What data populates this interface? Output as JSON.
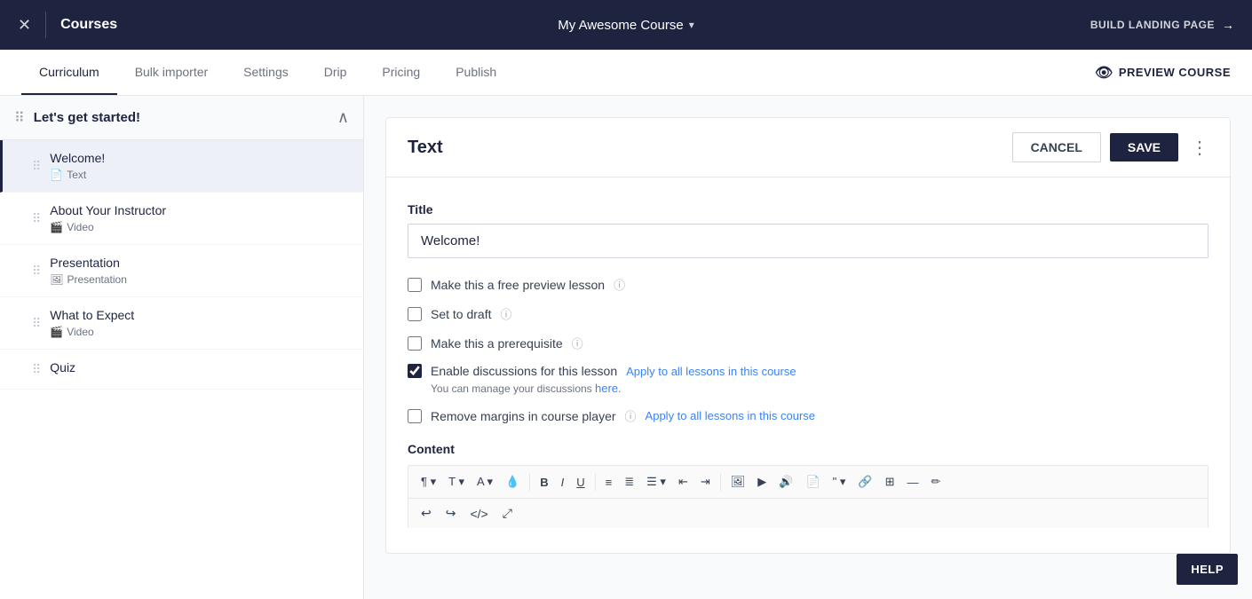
{
  "topBar": {
    "closeIcon": "✕",
    "coursesLabel": "Courses",
    "courseTitle": "My Awesome Course",
    "dropdownArrow": "▾",
    "buildLandingPage": "BUILD LANDING PAGE",
    "arrowRight": "→"
  },
  "tabs": [
    {
      "id": "curriculum",
      "label": "Curriculum",
      "active": true
    },
    {
      "id": "bulk-importer",
      "label": "Bulk importer",
      "active": false
    },
    {
      "id": "settings",
      "label": "Settings",
      "active": false
    },
    {
      "id": "drip",
      "label": "Drip",
      "active": false
    },
    {
      "id": "pricing",
      "label": "Pricing",
      "active": false
    },
    {
      "id": "publish",
      "label": "Publish",
      "active": false
    }
  ],
  "previewCourse": "PREVIEW COURSE",
  "sidebar": {
    "section": {
      "title": "Let's get started!"
    },
    "lessons": [
      {
        "id": "welcome",
        "title": "Welcome!",
        "type": "Text",
        "typeIcon": "📄",
        "active": true
      },
      {
        "id": "about",
        "title": "About Your Instructor",
        "type": "Video",
        "typeIcon": "🎬",
        "active": false
      },
      {
        "id": "presentation",
        "title": "Presentation",
        "type": "Presentation",
        "typeIcon": "🖼",
        "active": false
      },
      {
        "id": "expect",
        "title": "What to Expect",
        "type": "Video",
        "typeIcon": "🎬",
        "active": false
      },
      {
        "id": "quiz",
        "title": "Quiz",
        "type": "",
        "typeIcon": "",
        "active": false
      }
    ]
  },
  "editor": {
    "title": "Text",
    "cancelLabel": "CANCEL",
    "saveLabel": "SAVE",
    "fieldLabel": "Title",
    "titleValue": "Welcome!",
    "checkboxes": [
      {
        "id": "free-preview",
        "label": "Make this a free preview lesson",
        "checked": false,
        "hasInfo": true
      },
      {
        "id": "draft",
        "label": "Set to draft",
        "checked": false,
        "hasInfo": true
      },
      {
        "id": "prerequisite",
        "label": "Make this a prerequisite",
        "checked": false,
        "hasInfo": true
      },
      {
        "id": "discussions",
        "label": "Enable discussions for this lesson",
        "checked": true,
        "hasInfo": false,
        "hasLink": true,
        "linkText": "Apply to all lessons in this course"
      },
      {
        "id": "margins",
        "label": "Remove margins in course player",
        "checked": false,
        "hasInfo": true,
        "hasLink": true,
        "linkText": "Apply to all lessons in this course"
      }
    ],
    "discussionsSubtext": "You can manage your discussions ",
    "discussionsLinkText": "here.",
    "contentLabel": "Content"
  },
  "helpButton": "HELP"
}
